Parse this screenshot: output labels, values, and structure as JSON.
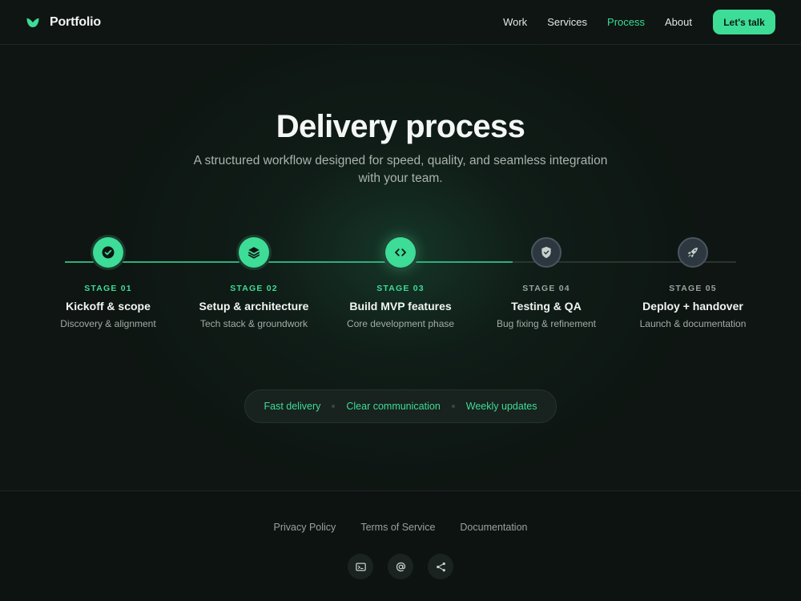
{
  "header": {
    "brand": "Portfolio",
    "nav": [
      {
        "label": "Work",
        "active": false
      },
      {
        "label": "Services",
        "active": false
      },
      {
        "label": "Process",
        "active": true
      },
      {
        "label": "About",
        "active": false
      }
    ],
    "cta_label": "Let's talk"
  },
  "hero": {
    "title": "Delivery process",
    "subtitle": "A structured workflow designed for speed, quality, and seamless integration with your team."
  },
  "stages": [
    {
      "label": "STAGE 01",
      "title": "Kickoff & scope",
      "desc": "Discovery & alignment",
      "status": "done",
      "icon": "check-circle-icon"
    },
    {
      "label": "STAGE 02",
      "title": "Setup & architecture",
      "desc": "Tech stack & groundwork",
      "status": "done",
      "icon": "layers-icon"
    },
    {
      "label": "STAGE 03",
      "title": "Build MVP features",
      "desc": "Core development phase",
      "status": "current",
      "icon": "code-icon"
    },
    {
      "label": "STAGE 04",
      "title": "Testing & QA",
      "desc": "Bug fixing & refinement",
      "status": "upcoming",
      "icon": "shield-check-icon"
    },
    {
      "label": "STAGE 05",
      "title": "Deploy + handover",
      "desc": "Launch & documentation",
      "status": "upcoming",
      "icon": "rocket-icon"
    }
  ],
  "highlights": [
    "Fast delivery",
    "Clear communication",
    "Weekly updates"
  ],
  "footer": {
    "links": [
      "Privacy Policy",
      "Terms of Service",
      "Documentation"
    ],
    "socials": [
      "terminal-icon",
      "at-sign-icon",
      "share-icon"
    ]
  },
  "colors": {
    "accent": "#3ddc97",
    "background": "#0e1512",
    "upcoming": "#2d3740"
  }
}
